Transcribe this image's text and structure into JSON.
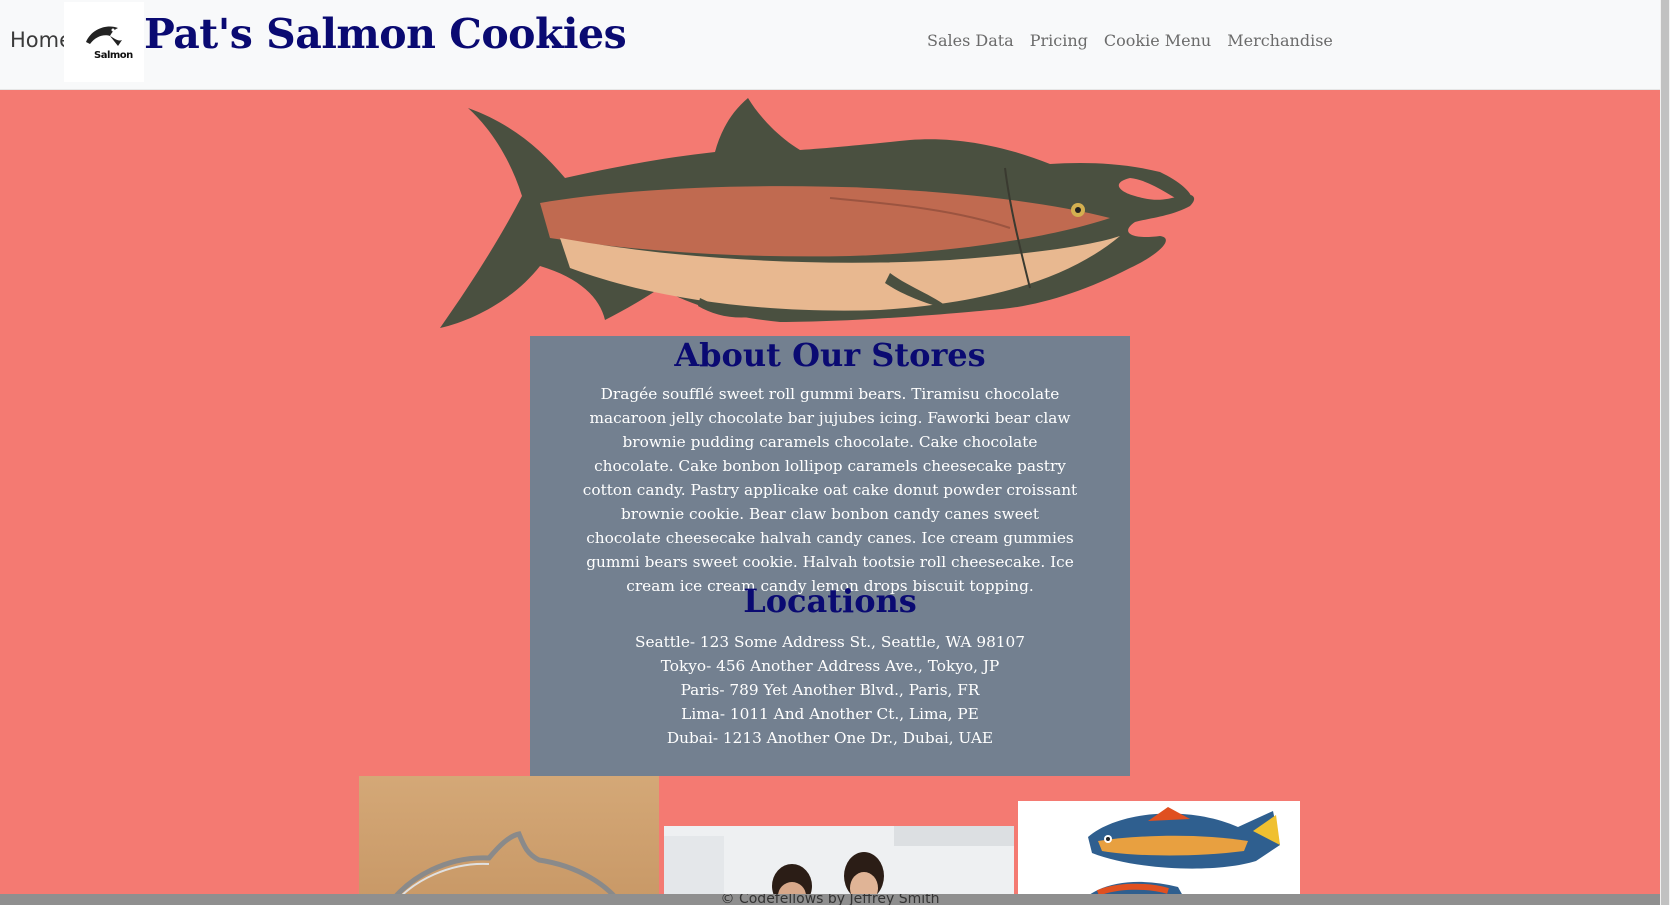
{
  "header": {
    "home_label": "Home",
    "logo_text": "Salmon",
    "title": "Pat's Salmon Cookies",
    "nav": [
      "Sales Data",
      "Pricing",
      "Cookie Menu",
      "Merchandise"
    ]
  },
  "about": {
    "title": "About Our Stores",
    "text": "Dragée soufflé sweet roll gummi bears. Tiramisu chocolate macaroon jelly chocolate bar jujubes icing. Faworki bear claw brownie pudding caramels chocolate. Cake chocolate chocolate. Cake bonbon lollipop caramels cheesecake pastry cotton candy. Pastry applicake oat cake donut powder croissant brownie cookie. Bear claw bonbon candy canes sweet chocolate cheesecake halvah candy canes. Ice cream gummies gummi bears sweet cookie. Halvah tootsie roll cheesecake. Ice cream ice cream candy lemon drops biscuit topping."
  },
  "locations": {
    "title": "Locations",
    "items": [
      "Seattle- 123 Some Address St., Seattle, WA 98107",
      "Tokyo- 456 Another Address Ave., Tokyo, JP",
      "Paris- 789 Yet Another Blvd., Paris, FR",
      "Lima- 1011 And Another Ct., Lima, PE",
      "Dubai- 1213 Another One Dr., Dubai, UAE"
    ]
  },
  "footer": {
    "text": "© Codefellows by Jeffrey Smith"
  },
  "colors": {
    "page_background": "#f47a72",
    "header_background": "#f8f9fa",
    "panel_background": "#738090",
    "title_color": "#0a0a72"
  },
  "icons": [
    "salmon-logo-icon"
  ]
}
